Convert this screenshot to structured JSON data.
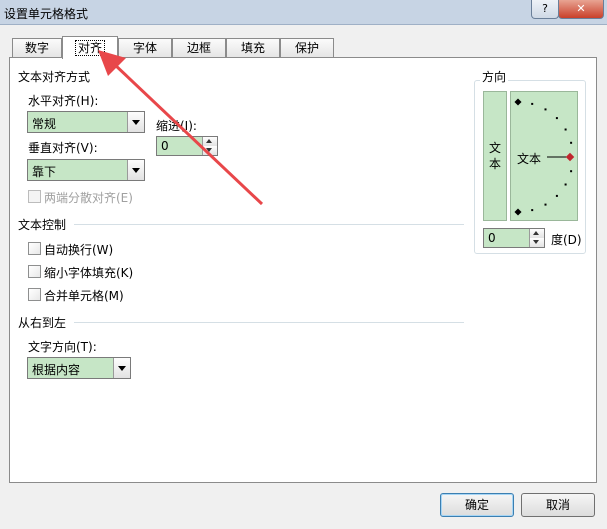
{
  "window": {
    "title": "设置单元格格式",
    "help_label": "?",
    "close_label": "✕"
  },
  "tabs": [
    {
      "label": "数字"
    },
    {
      "label": "对齐"
    },
    {
      "label": "字体"
    },
    {
      "label": "边框"
    },
    {
      "label": "填充"
    },
    {
      "label": "保护"
    }
  ],
  "active_tab": "对齐",
  "text_alignment": {
    "section_title": "文本对齐方式",
    "horizontal_label": "水平对齐(H):",
    "horizontal_value": "常规",
    "indent_label": "缩进(I):",
    "indent_value": "0",
    "vertical_label": "垂直对齐(V):",
    "vertical_value": "靠下",
    "distributed_label": "两端分散对齐(E)"
  },
  "text_control": {
    "section_title": "文本控制",
    "wrap_text_label": "自动换行(W)",
    "shrink_to_fit_label": "缩小字体填充(K)",
    "merge_cells_label": "合并单元格(M)"
  },
  "right_to_left": {
    "section_title": "从右到左",
    "text_direction_label": "文字方向(T):",
    "text_direction_value": "根据内容"
  },
  "orientation": {
    "section_title": "方向",
    "vertical_text": "文本",
    "dial_text": "文本",
    "degrees_value": "0",
    "degrees_label": "度(D)"
  },
  "footer": {
    "ok_label": "确定",
    "cancel_label": "取消"
  },
  "colors": {
    "field_bg": "#c6e6c6",
    "annotation_arrow": "#e8474a",
    "dial_dot": "#000000",
    "dial_marker": "#c0262d"
  }
}
